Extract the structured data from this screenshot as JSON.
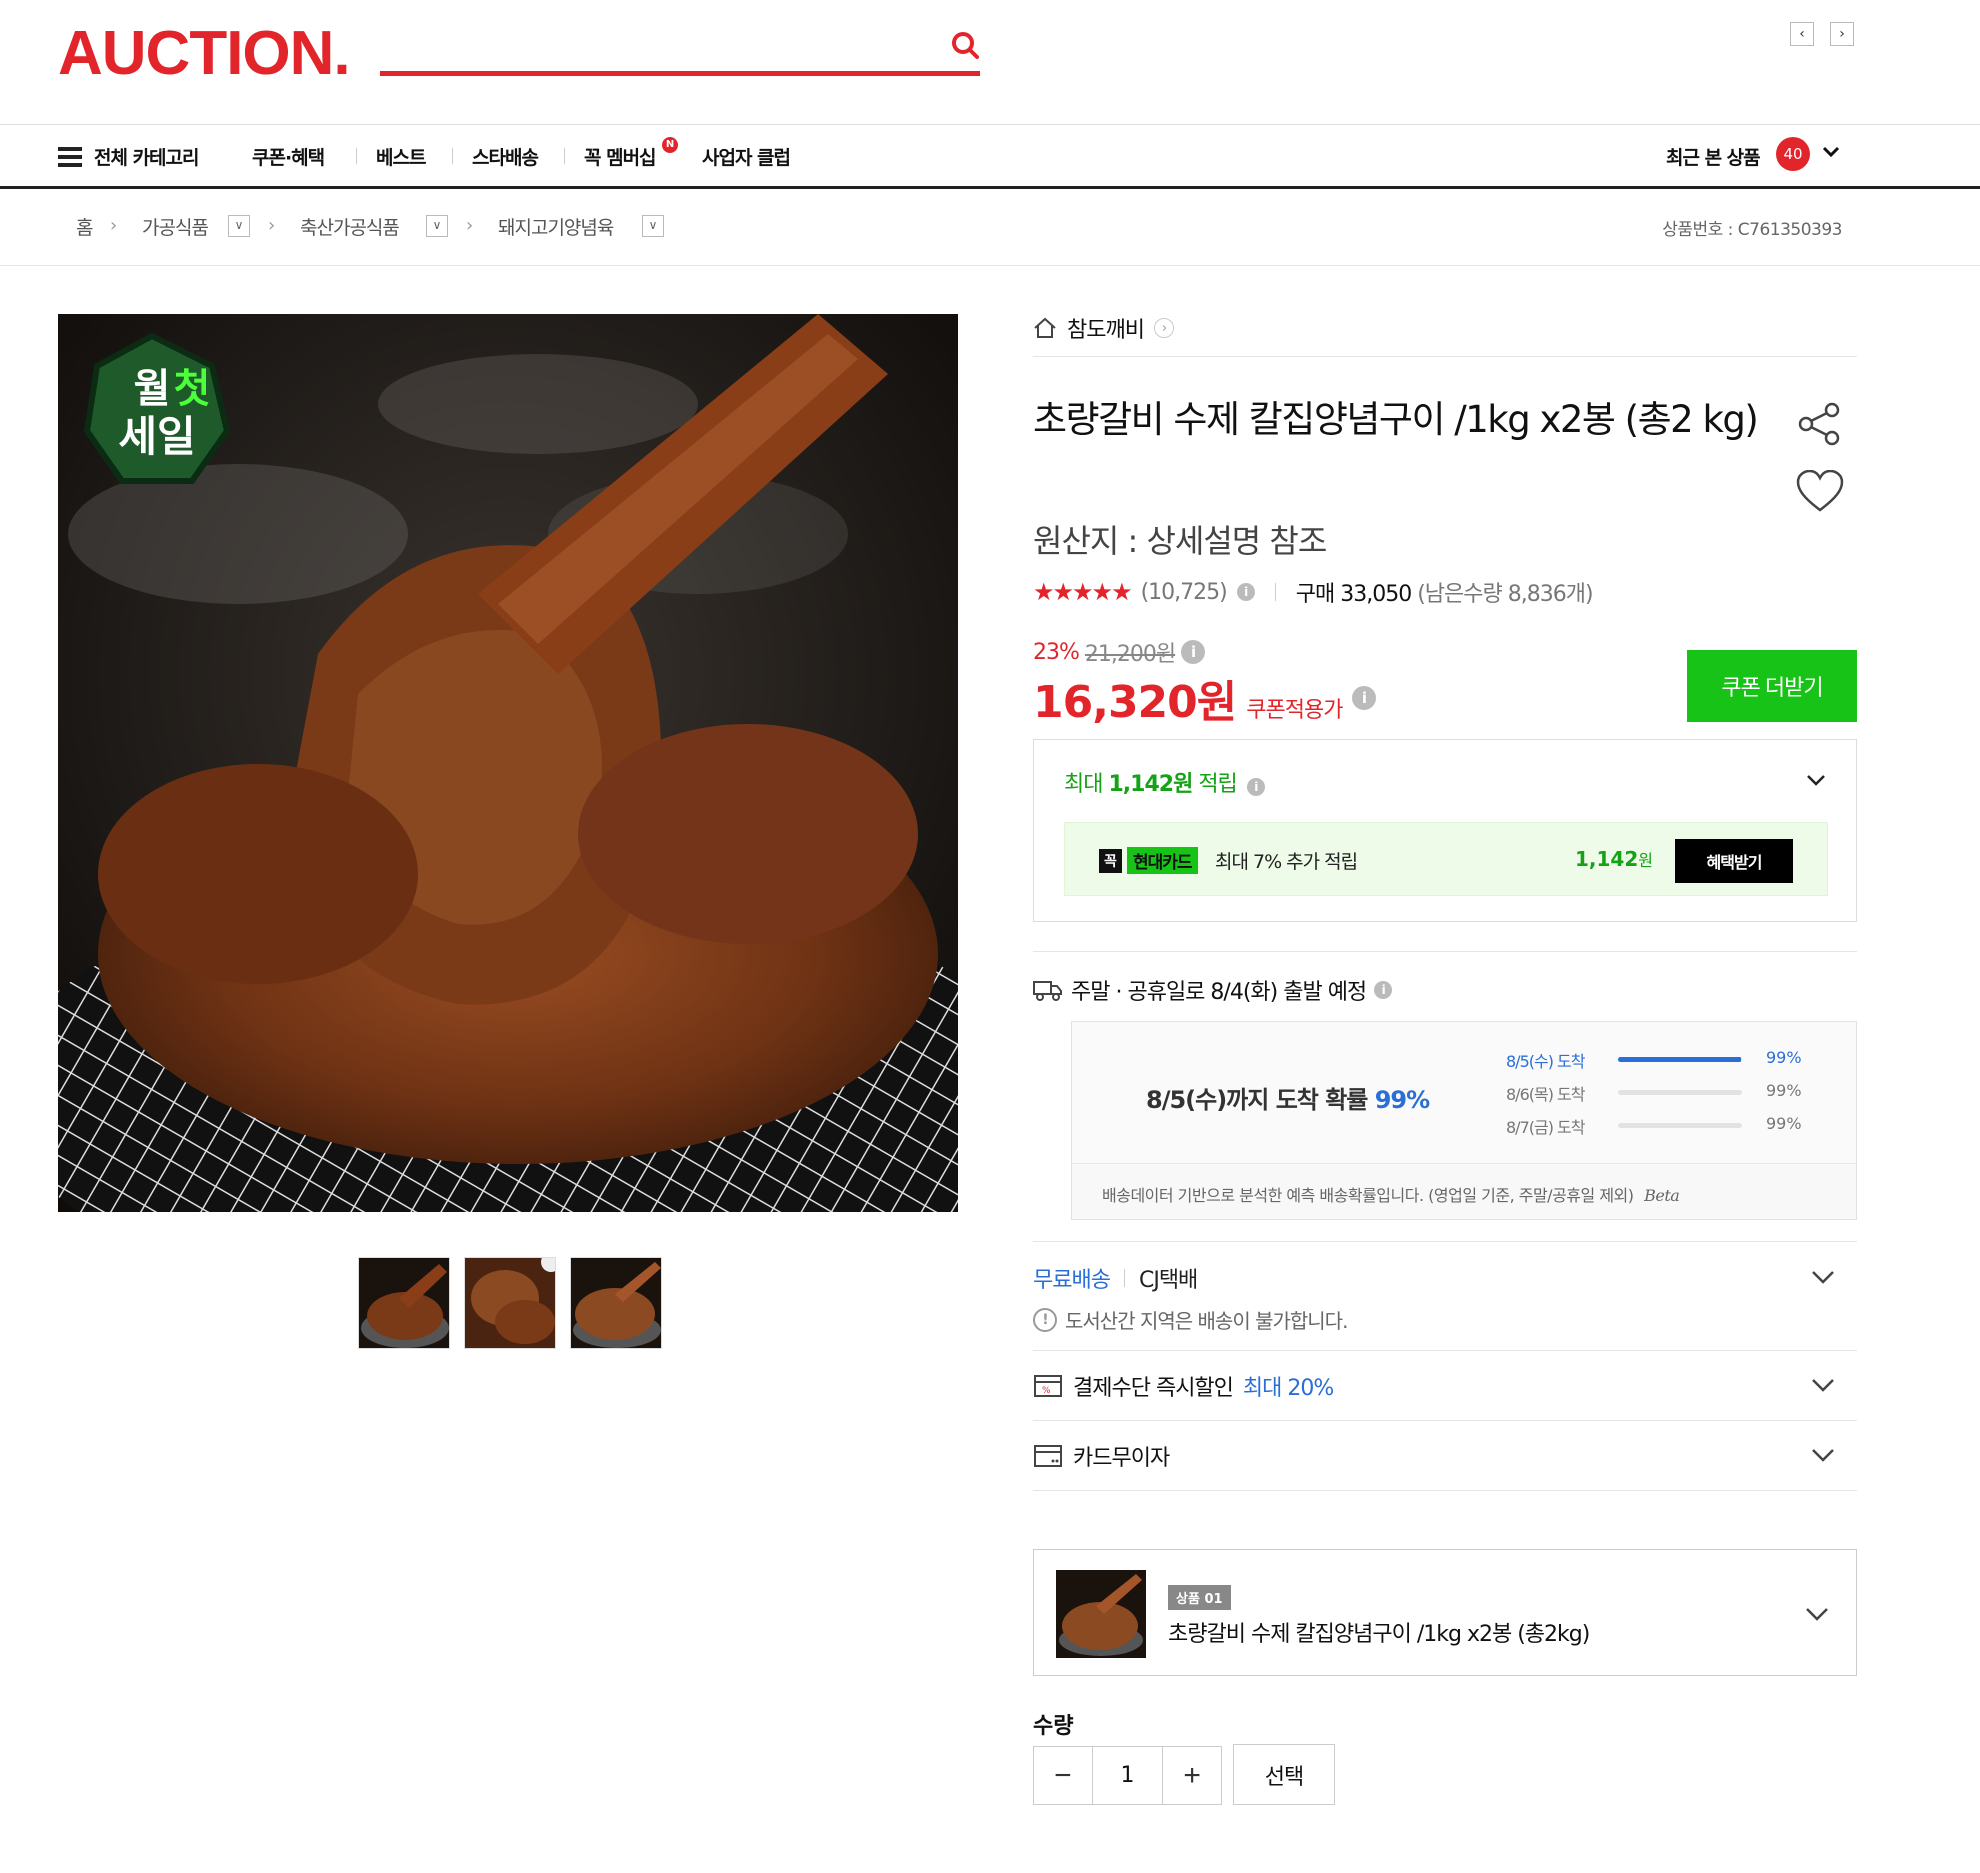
{
  "header": {
    "logo": "AUCTION.",
    "search_value": "",
    "search_placeholder": ""
  },
  "gnb": {
    "all_categories": "전체 카테고리",
    "items": [
      "쿠폰·혜택",
      "베스트",
      "스타배송",
      "꼭 멤버십",
      "사업자 클럽"
    ],
    "membership_badge": "N",
    "recent_label": "최근 본 상품",
    "recent_count": "40"
  },
  "breadcrumb": {
    "home": "홈",
    "levels": [
      "가공식품",
      "축산가공식품",
      "돼지고기양념육"
    ],
    "product_id": "상품번호 : C761350393"
  },
  "product": {
    "shop": "참도깨비",
    "title": "초량갈비 수제 칼집양념구이 /1kg x2봉 (총2 kg)",
    "origin": "원산지 : 상세설명 참조",
    "rating_stars": 4.5,
    "reviews": "(10,725)",
    "purchases": "구매 33,050",
    "remaining": "(남은수량 8,836개)",
    "discount_pct": "23%",
    "original_price": "21,200원",
    "price": "16,320원",
    "price_label": "쿠폰적용가",
    "coupon_button": "쿠폰 더받기",
    "badge_text": [
      "월",
      "첫",
      "세일"
    ]
  },
  "reward": {
    "prefix": "최대",
    "amount": "1,142원",
    "suffix": "적립",
    "card_brand_prefix": "꼭",
    "card_brand": "현대카드",
    "card_text": "최대 7% 추가 적립",
    "card_amount_num": "1,142",
    "card_amount_unit": "원",
    "benefit_button": "혜택받기"
  },
  "shipping": {
    "departure": "주말 · 공휴일로 8/4(화) 출발 예정",
    "headline_prefix": "8/5(수)까지 도착 확률",
    "headline_pct": "99%",
    "rows": [
      {
        "label": "8/5(수) 도착",
        "pct": "99%",
        "fill": 0.99
      },
      {
        "label": "8/6(목) 도착",
        "pct": "99%",
        "fill": 0
      },
      {
        "label": "8/7(금) 도착",
        "pct": "99%",
        "fill": 0
      }
    ],
    "note": "배송데이터 기반으로 분석한 예측 배송확률입니다. (영업일 기준, 주말/공휴일 제외)",
    "beta": "Beta",
    "free_shipping": "무료배송",
    "carrier": "CJ택배",
    "island_notice": "도서산간 지역은 배송이 불가합니다."
  },
  "payment": {
    "instant_discount": "결제수단 즉시할인",
    "instant_max": "최대 20%",
    "installment": "카드무이자"
  },
  "option": {
    "tag": "상품 01",
    "name": "초량갈비 수제 칼집양념구이 /1kg x2봉 (총2kg)"
  },
  "quantity": {
    "label": "수량",
    "value": "1",
    "minus": "−",
    "plus": "+",
    "select_button": "선택"
  },
  "colors": {
    "brand_red": "#e2252b",
    "green": "#16c316",
    "blue": "#2a6fd8"
  }
}
